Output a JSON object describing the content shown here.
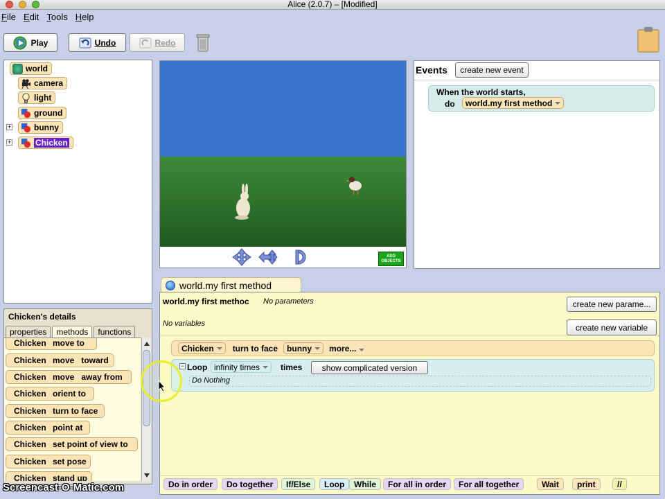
{
  "window": {
    "title": "Alice (2.0.7) –   [Modified]"
  },
  "menu": [
    "File",
    "Edit",
    "Tools",
    "Help"
  ],
  "toolbar": {
    "play": "Play",
    "undo": "Undo",
    "redo": "Redo"
  },
  "tree": [
    {
      "label": "world",
      "icon": "world-icon",
      "expandable": false,
      "selected": false
    },
    {
      "label": "camera",
      "icon": "camera-icon",
      "expandable": false,
      "selected": false
    },
    {
      "label": "light",
      "icon": "lightbulb-icon",
      "expandable": false,
      "selected": false
    },
    {
      "label": "ground",
      "icon": "object-icon",
      "expandable": false,
      "selected": false
    },
    {
      "label": "bunny",
      "icon": "object-icon",
      "expandable": true,
      "selected": false
    },
    {
      "label": "Chicken",
      "icon": "object-icon",
      "expandable": true,
      "selected": true
    }
  ],
  "scene": {
    "add_objects": [
      "ADD",
      "OBJECTS"
    ]
  },
  "events": {
    "title": "Events",
    "create_button": "create new event",
    "when_text": "When the world starts,",
    "do_text": "do",
    "method": "world.my first method"
  },
  "details": {
    "title": "Chicken's details",
    "tabs": [
      "properties",
      "methods",
      "functions"
    ],
    "active_tab": "methods",
    "methods": [
      {
        "obj": "Chicken",
        "name": "move to"
      },
      {
        "obj": "Chicken",
        "name": "move   toward"
      },
      {
        "obj": "Chicken",
        "name": "move   away from"
      },
      {
        "obj": "Chicken",
        "name": "orient to"
      },
      {
        "obj": "Chicken",
        "name": "turn to face"
      },
      {
        "obj": "Chicken",
        "name": "point at"
      },
      {
        "obj": "Chicken",
        "name": "set point of view to"
      },
      {
        "obj": "Chicken",
        "name": "set pose"
      },
      {
        "obj": "Chicken",
        "name": "stand up"
      }
    ]
  },
  "editor": {
    "tab": "world.my first method",
    "header": "world.my first methoc",
    "params": "No parameters",
    "create_param": "create new parame...",
    "vars": "No variables",
    "create_var": "create new variable",
    "stmt1": {
      "obj": "Chicken",
      "method": "turn to face",
      "arg": "bunny",
      "more": "more..."
    },
    "loop": {
      "label": "Loop",
      "count": "infinity times",
      "times": "times",
      "complicated": "show complicated version",
      "body": "Do Nothing"
    }
  },
  "bottom_bar": [
    {
      "label": "Do in order",
      "color": "#e3d7f1"
    },
    {
      "label": "Do together",
      "color": "#e3d7f1"
    },
    {
      "label": "If/Else",
      "color": "#dff5d6"
    },
    {
      "label": "Loop",
      "color": "#d6eef5"
    },
    {
      "label": "While",
      "color": "#dff5d6"
    },
    {
      "label": "For all in order",
      "color": "#e3d7f1"
    },
    {
      "label": "For all together",
      "color": "#e3d7f1"
    },
    {
      "label": "Wait",
      "color": "#fbe4b5"
    },
    {
      "label": "print",
      "color": "#fbe4b5"
    },
    {
      "label": "//",
      "color": "#f5f5a8"
    }
  ],
  "watermark": "Screencast-O-Matic.com"
}
